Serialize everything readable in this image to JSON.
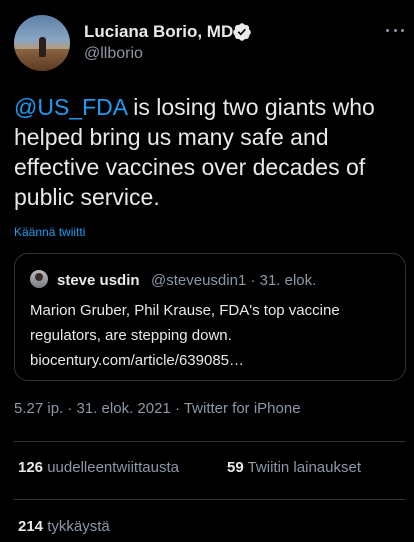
{
  "author": {
    "name": "Luciana Borio, MD",
    "handle": "@llborio"
  },
  "tweet": {
    "mention": "@US_FDA",
    "text": " is losing two giants who helped bring us many safe and effective vaccines over decades of public service.",
    "translate_label": "Käännä twiitti"
  },
  "quote": {
    "name": "steve usdin",
    "meta": "@steveusdin1 · 31. elok.",
    "lines": [
      "Marion Gruber, Phil Krause, FDA's top vaccine",
      "regulators, are stepping down.",
      "biocentury.com/article/639085…"
    ]
  },
  "timestamp": "5.27 ip. · 31. elok. 2021 · Twitter for iPhone",
  "stats": {
    "retweets": {
      "count": "126",
      "label": "uudelleentwiittausta"
    },
    "quotes": {
      "count": "59",
      "label": "Twiitin lainaukset"
    },
    "likes": {
      "count": "214",
      "label": "tykkäystä"
    }
  },
  "colors": {
    "background": "#000000",
    "text": "#e7e9ea",
    "secondary": "#8b98a5",
    "link": "#1d9bf0",
    "border": "#2f3336"
  },
  "icons": [
    "verified-icon",
    "more-icon"
  ]
}
